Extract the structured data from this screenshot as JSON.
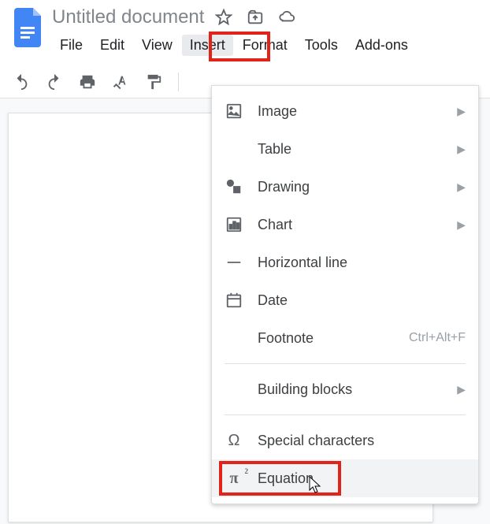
{
  "document": {
    "title": "Untitled document"
  },
  "menubar": {
    "file": "File",
    "edit": "Edit",
    "view": "View",
    "insert": "Insert",
    "format": "Format",
    "tools": "Tools",
    "addons": "Add-ons"
  },
  "insert_menu": {
    "image": "Image",
    "table": "Table",
    "drawing": "Drawing",
    "chart": "Chart",
    "horizontal_line": "Horizontal line",
    "date": "Date",
    "footnote": "Footnote",
    "footnote_shortcut": "Ctrl+Alt+F",
    "building_blocks": "Building blocks",
    "special_characters": "Special characters",
    "equation": "Equation"
  }
}
